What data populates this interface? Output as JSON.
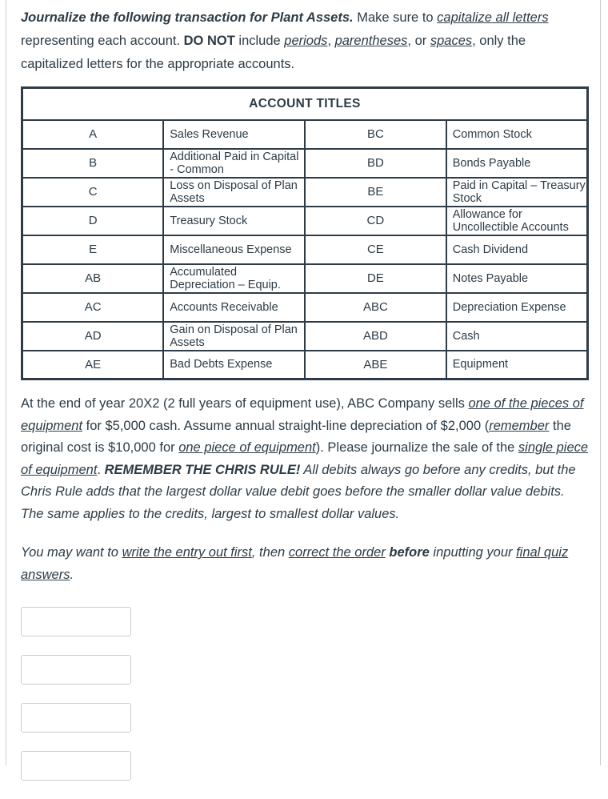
{
  "intro": {
    "lead_bold_italic": "Journalize the following transaction for Plant Assets.",
    "t1": " Make sure to ",
    "u1": "capitalize all letters",
    "t2": " representing each account. ",
    "b1": "DO NOT",
    "t3": " include ",
    "u2": "periods",
    "t4": ", ",
    "u3": "parentheses",
    "t5": ", or ",
    "u4": "spaces",
    "t6": ", only the capitalized letters for the appropriate accounts."
  },
  "table": {
    "header": "ACCOUNT TITLES",
    "rows": [
      {
        "code_left": "A",
        "name_left": "Sales Revenue",
        "code_right": "BC",
        "name_right": "Common Stock"
      },
      {
        "code_left": "B",
        "name_left": "Additional Paid in Capital - Common",
        "code_right": "BD",
        "name_right": "Bonds Payable"
      },
      {
        "code_left": "C",
        "name_left": "Loss on Disposal of Plan Assets",
        "code_right": "BE",
        "name_right": "Paid in Capital – Treasury Stock"
      },
      {
        "code_left": "D",
        "name_left": "Treasury Stock",
        "code_right": "CD",
        "name_right": "Allowance for Uncollectible Accounts"
      },
      {
        "code_left": "E",
        "name_left": "Miscellaneous Expense",
        "code_right": "CE",
        "name_right": "Cash Dividend"
      },
      {
        "code_left": "AB",
        "name_left": "Accumulated Depreciation – Equip.",
        "code_right": "DE",
        "name_right": "Notes Payable"
      },
      {
        "code_left": "AC",
        "name_left": "Accounts Receivable",
        "code_right": "ABC",
        "name_right": "Depreciation Expense"
      },
      {
        "code_left": "AD",
        "name_left": "Gain on Disposal of Plan Assets",
        "code_right": "ABD",
        "name_right": "Cash"
      },
      {
        "code_left": "AE",
        "name_left": "Bad Debts Expense",
        "code_right": "ABE",
        "name_right": "Equipment"
      }
    ]
  },
  "scenario": {
    "s1": "At the end of year 20X2 (2 full years of equipment use), ABC Company sells ",
    "u1": "one of the pieces of equipment",
    "s2": " for $5,000 cash. Assume annual straight-line depreciation of $2,000 (",
    "iu1": "remember",
    "s3": " the original cost is $10,000 for ",
    "iu2": "one piece of equipment",
    "s4": "). Please journalize the sale of the ",
    "u2": "single piece of equipment",
    "s5": ". ",
    "bi1": "REMEMBER THE CHRIS RULE!",
    "i1": " All debits always go before any credits, but the Chris Rule adds that the largest dollar value debit goes before the smaller dollar value debits. The same applies to the credits, largest to smallest dollar values."
  },
  "hint": {
    "h1": "You may want to ",
    "u1": "write the entry out first",
    "h2": ", then ",
    "u2": "correct the order",
    "b1": " before",
    "h3": " inputting your ",
    "u3": "final quiz answers",
    "h4": "."
  },
  "answers": {
    "placeholder": "",
    "values": [
      "",
      "",
      "",
      ""
    ]
  },
  "colors": {
    "text": "#2d3b45",
    "table_border": "#2f3c47",
    "input_border": "#c7cdd1",
    "pane_rule": "#c7cdd1"
  }
}
